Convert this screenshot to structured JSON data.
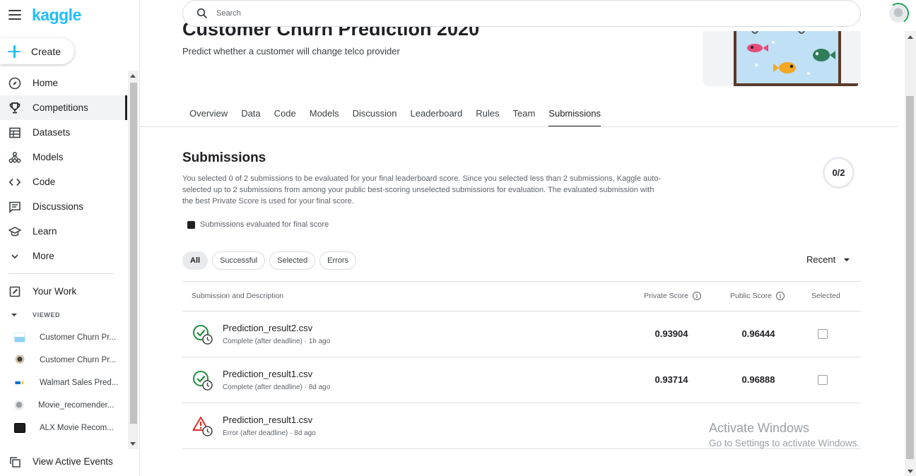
{
  "brand": {
    "logo": "kaggle",
    "accent": "#20beff"
  },
  "sidebar": {
    "create_label": "Create",
    "items": [
      {
        "label": "Home",
        "icon": "compass-icon"
      },
      {
        "label": "Competitions",
        "icon": "trophy-icon",
        "active": true
      },
      {
        "label": "Datasets",
        "icon": "table-icon"
      },
      {
        "label": "Models",
        "icon": "models-icon"
      },
      {
        "label": "Code",
        "icon": "code-icon"
      },
      {
        "label": "Discussions",
        "icon": "discussions-icon"
      },
      {
        "label": "Learn",
        "icon": "graduation-cap-icon"
      },
      {
        "label": "More",
        "icon": "chevron-down-icon"
      }
    ],
    "your_work": "Your Work",
    "viewed_label": "VIEWED",
    "viewed": [
      {
        "label": "Customer Churn Pr..."
      },
      {
        "label": "Customer Churn Pr..."
      },
      {
        "label": "Walmart Sales Pred..."
      },
      {
        "label": "Movie_recomender..."
      },
      {
        "label": "ALX Movie Recom..."
      }
    ],
    "active_events": "View Active Events"
  },
  "search": {
    "placeholder": "Search"
  },
  "competition": {
    "title": "Customer Churn Prediction 2020",
    "subtitle": "Predict whether a customer will change telco provider"
  },
  "tabs": [
    {
      "label": "Overview"
    },
    {
      "label": "Data"
    },
    {
      "label": "Code"
    },
    {
      "label": "Models"
    },
    {
      "label": "Discussion"
    },
    {
      "label": "Leaderboard"
    },
    {
      "label": "Rules"
    },
    {
      "label": "Team"
    },
    {
      "label": "Submissions",
      "active": true
    }
  ],
  "submissions": {
    "title": "Submissions",
    "description": "You selected 0 of 2 submissions to be evaluated for your final leaderboard score. Since you selected less than 2 submissions, Kaggle auto-selected up to 2 submissions from among your public best-scoring unselected submissions for evaluation. The evaluated submission with the best Private Score is used for your final score.",
    "selected_count": "0/2",
    "legend": "Submissions evaluated for final score",
    "filters": [
      "All",
      "Successful",
      "Selected",
      "Errors"
    ],
    "sort": "Recent",
    "columns": {
      "submission": "Submission and Description",
      "private": "Private Score",
      "public": "Public Score",
      "selected": "Selected",
      "info": "i"
    },
    "rows": [
      {
        "file": "Prediction_result2.csv",
        "meta": "Complete (after deadline) · 1h ago",
        "status": "success",
        "private": "0.93904",
        "public": "0.96444"
      },
      {
        "file": "Prediction_result1.csv",
        "meta": "Complete (after deadline) · 8d ago",
        "status": "success",
        "private": "0.93714",
        "public": "0.96888"
      },
      {
        "file": "Prediction_result1.csv",
        "meta": "Error (after deadline) · 8d ago",
        "status": "error",
        "private": "",
        "public": ""
      }
    ]
  },
  "watermark": {
    "line1": "Activate Windows",
    "line2": "Go to Settings to activate Windows."
  },
  "colors": {
    "success": "#1e8e3e",
    "error": "#d93025"
  }
}
